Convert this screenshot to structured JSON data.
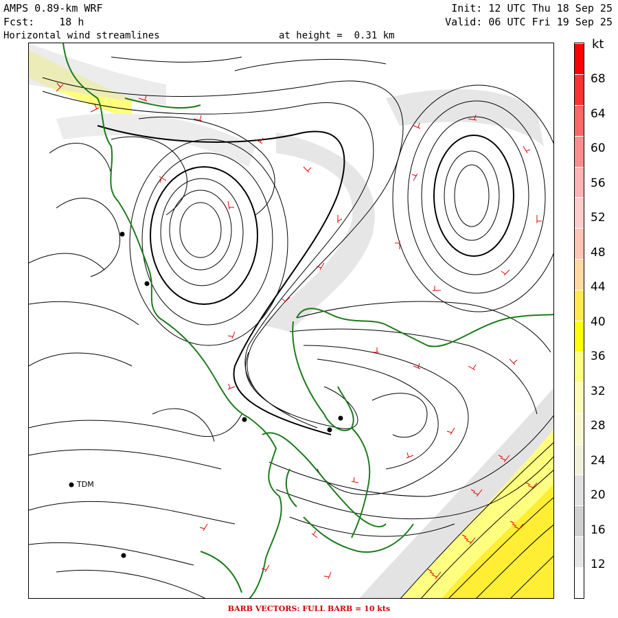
{
  "header": {
    "model": "AMPS 0.89-km WRF",
    "forecast": "Fcst:    18 h",
    "field": "Horizontal wind streamlines",
    "height": "at height =  0.31 km",
    "init": "Init: 12 UTC Thu 18 Sep 25",
    "valid": "Valid: 06 UTC Fri 19 Sep 25"
  },
  "colorbar": {
    "unit": "kt",
    "labels": [
      "12",
      "16",
      "20",
      "24",
      "28",
      "32",
      "36",
      "40",
      "44",
      "48",
      "52",
      "56",
      "60",
      "64",
      "68"
    ],
    "colors": [
      "#ffffff",
      "#e6e6e6",
      "#cfcfcf",
      "#e0e0e0",
      "#f2f2da",
      "#f8f8cc",
      "#fbfbb5",
      "#fdfd80",
      "#ffff00",
      "#ffe94d",
      "#ffd9a0",
      "#ffc4b4",
      "#ffcccc",
      "#ffb3b3",
      "#ff8c8c",
      "#ff6666",
      "#ff3030",
      "#ff0000"
    ]
  },
  "stations": [
    {
      "name": "TDM"
    }
  ],
  "footer": "BARB VECTORS:  FULL BARB = 10 kts",
  "colors": {
    "coastline": "#1a7a1a",
    "barb": "#e00000",
    "streamline": "#000000"
  }
}
